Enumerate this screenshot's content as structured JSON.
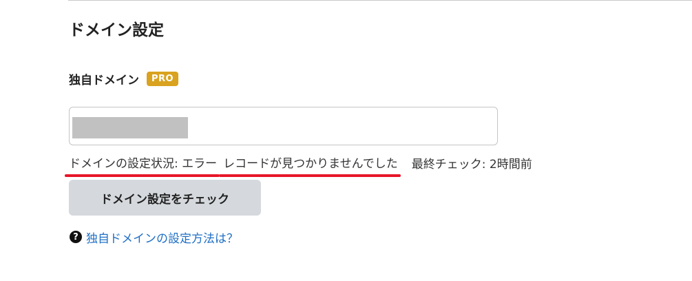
{
  "section": {
    "title": "ドメイン設定"
  },
  "custom_domain": {
    "label": "独自ドメイン",
    "badge": "PRO",
    "input_value": ""
  },
  "status": {
    "prefix": "ドメインの設定状況: エラー",
    "detail": "レコードが見つかりませんでした",
    "last_check": "最終チェック: 2時間前",
    "underline_color": "#e8162a"
  },
  "actions": {
    "check_button_label": "ドメイン設定をチェック"
  },
  "help": {
    "icon": "question-circle-icon",
    "icon_glyph": "?",
    "link_text": "独自ドメインの設定方法は？"
  },
  "colors": {
    "badge": "#d9a21f",
    "button_bg": "#d5d9dd",
    "link": "#1f6fc5"
  }
}
